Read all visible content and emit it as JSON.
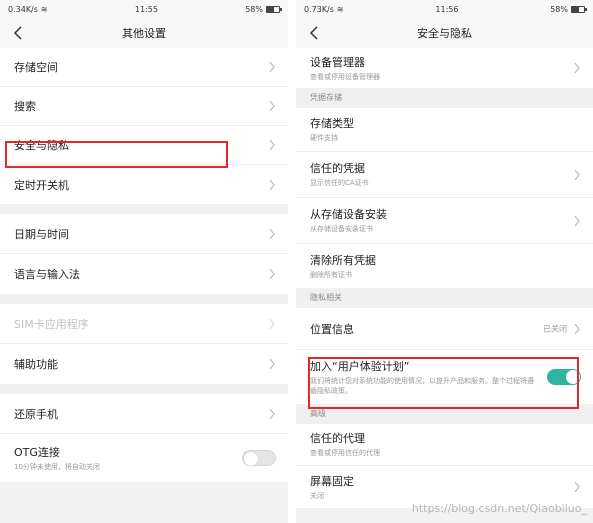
{
  "left": {
    "status": {
      "speed": "0.34K/s",
      "time": "11:55",
      "battery": "58%",
      "battery_level": 0.58
    },
    "title": "其他设置",
    "groups": [
      {
        "items": [
          {
            "label": "存储空间"
          },
          {
            "label": "搜索"
          },
          {
            "label": "安全与隐私"
          },
          {
            "label": "定时开关机"
          }
        ]
      },
      {
        "items": [
          {
            "label": "日期与时间"
          },
          {
            "label": "语言与输入法"
          }
        ]
      },
      {
        "items": [
          {
            "label": "SIM卡应用程序",
            "disabled": true
          },
          {
            "label": "辅助功能"
          }
        ]
      },
      {
        "items": [
          {
            "label": "还原手机"
          },
          {
            "label": "OTG连接",
            "sub": "10分钟未使用，将自动关闭",
            "toggle": false
          }
        ]
      }
    ]
  },
  "right": {
    "status": {
      "speed": "0.73K/s",
      "time": "11:56",
      "battery": "58%",
      "battery_level": 0.58
    },
    "title": "安全与隐私",
    "top": {
      "label": "设备管理器",
      "sub": "查看或停用设备管理器"
    },
    "sections": [
      {
        "header": "凭据存储",
        "items": [
          {
            "label": "存储类型",
            "sub": "硬件支持"
          },
          {
            "label": "信任的凭据",
            "sub": "显示信任的CA证书"
          },
          {
            "label": "从存储设备安装",
            "sub": "从存储设备安装证书"
          },
          {
            "label": "清除所有凭据",
            "sub": "删除所有证书"
          }
        ]
      },
      {
        "header": "隐私相关",
        "items": [
          {
            "label": "位置信息",
            "value": "已关闭"
          },
          {
            "label": "加入“用户体验计划”",
            "sub": "我们将统计您对系统功能的使用情况，以提升产品和服务。整个过程将遵循隐私政策。",
            "toggle": true
          }
        ]
      },
      {
        "header": "高级",
        "items": [
          {
            "label": "信任的代理",
            "sub": "查看或停用信任的代理"
          },
          {
            "label": "屏幕固定",
            "sub": "关闭"
          }
        ]
      }
    ]
  },
  "watermark": "https://blog.csdn.net/Qiaobiluo_",
  "colors": {
    "highlight": "#e02a2a",
    "toggle_on": "#2fb5a0",
    "toggle_off": "#e4e4e4"
  }
}
